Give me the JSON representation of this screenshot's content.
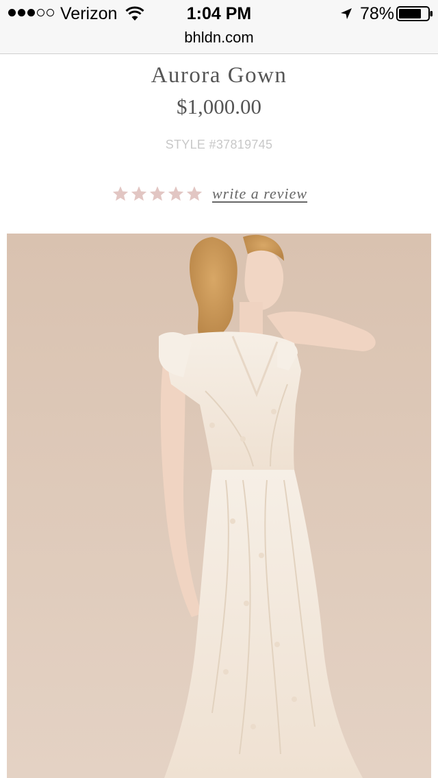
{
  "status_bar": {
    "carrier": "Verizon",
    "time": "1:04 PM",
    "battery_percent": "78%",
    "battery_level": 0.78,
    "signal_bars_filled": 3,
    "signal_bars_total": 5
  },
  "browser": {
    "url": "bhldn.com"
  },
  "product": {
    "name": "Aurora Gown",
    "price": "$1,000.00",
    "style": "STYLE #37819745",
    "rating": {
      "stars_total": 5,
      "stars_filled": 0,
      "star_color": "#e2c6c3"
    },
    "review_link": "write a review"
  },
  "icons": {
    "wifi": "wifi-icon",
    "location": "location-arrow-icon",
    "battery": "battery-icon",
    "star": "star-icon"
  },
  "colors": {
    "image_background": "#dcc6b4",
    "gown": "#f4ece0"
  }
}
